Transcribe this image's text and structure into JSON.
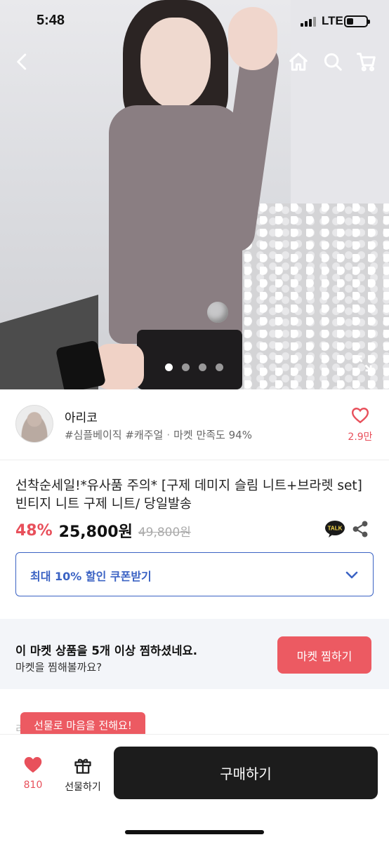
{
  "status_bar": {
    "time": "5:48",
    "network": "LTE"
  },
  "header": {
    "back_icon": "chevron-left-icon",
    "home_icon": "home-icon",
    "search_icon": "search-icon",
    "cart_icon": "cart-icon"
  },
  "gallery": {
    "image_count": 4,
    "active_index": 0,
    "expand_icon": "expand-icon"
  },
  "seller": {
    "name": "아리코",
    "tags": "#심플베이직 #캐주얼",
    "satisfaction": "마켓 만족도 94%",
    "like_count": "2.9만"
  },
  "product": {
    "title": "선착순세일!*유사품 주의* [구제 데미지 슬림 니트+브라렛 set] 빈티지 니트 구제 니트/ 당일발송",
    "discount": "48%",
    "price": "25,800원",
    "original_price": "49,800원",
    "talk_label": "TALK",
    "share_icon": "share-icon"
  },
  "coupon": {
    "label": "최대 10% 할인 쿠폰받기"
  },
  "market_banner": {
    "line1": "이 마켓 상품을 5개 이상 찜하셨네요.",
    "line2": "마켓을 찜해볼까요?",
    "button": "마켓 찜하기"
  },
  "tooltip": {
    "text": "선물로 마음을 전해요!",
    "peek_text": "리"
  },
  "bottom_bar": {
    "like_count": "810",
    "gift_label": "선물하기",
    "buy_label": "구매하기"
  },
  "colors": {
    "accent": "#e8505b",
    "coupon_blue": "#3b63c4",
    "buy_black": "#1c1c1c"
  }
}
